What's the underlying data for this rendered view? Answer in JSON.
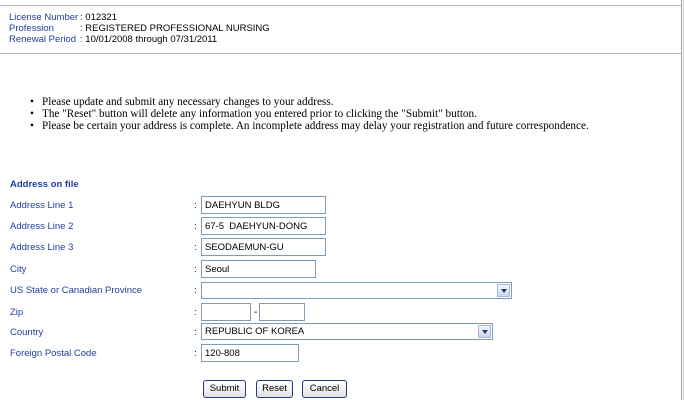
{
  "license": {
    "number_label": "License Number",
    "number_value": "012321",
    "profession_label": "Profession",
    "profession_value": "REGISTERED PROFESSIONAL NURSING",
    "renewal_label": "Renewal Period",
    "renewal_value": "10/01/2008 through 07/31/2011"
  },
  "instructions": [
    "Please update and submit any necessary changes to your address.",
    "The \"Reset\" button will delete any information you entered prior to clicking the \"Submit\" button.",
    "Please be certain your address is complete. An incomplete address may delay your registration and future correspondence."
  ],
  "form": {
    "heading": "Address on file",
    "colon": ":",
    "fields": {
      "line1": {
        "label": "Address Line 1",
        "value": "DAEHYUN BLDG"
      },
      "line2": {
        "label": "Address Line 2",
        "value": "67-5  DAEHYUN-DONG"
      },
      "line3": {
        "label": "Address Line 3",
        "value": "SEODAEMUN-GU"
      },
      "city": {
        "label": "City",
        "value": "Seoul"
      },
      "state": {
        "label": "US State or Canadian Province",
        "value": ""
      },
      "zip": {
        "label": "Zip",
        "value1": "",
        "value2": "",
        "separator": "-"
      },
      "country": {
        "label": "Country",
        "value": "REPUBLIC OF KOREA"
      },
      "postal": {
        "label": "Foreign Postal Code",
        "value": "120-808"
      }
    }
  },
  "buttons": {
    "submit": "Submit",
    "reset": "Reset",
    "cancel": "Cancel"
  }
}
